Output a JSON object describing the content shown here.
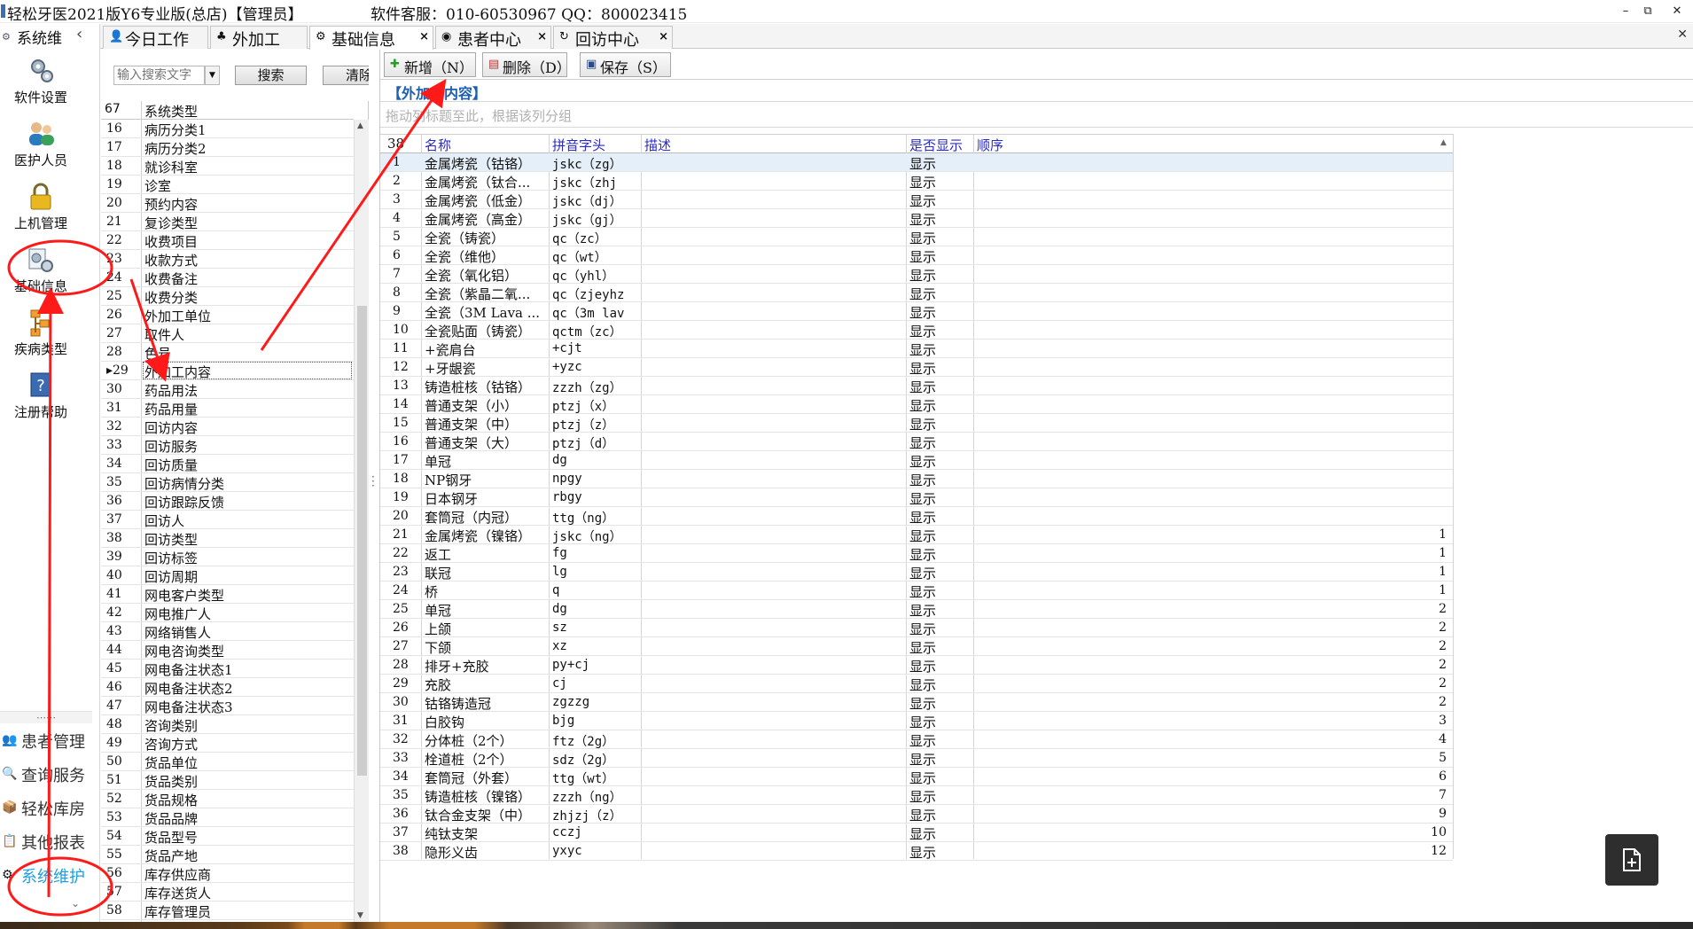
{
  "window": {
    "title": "轻松牙医2021版Y6专业版(总店)【管理员】",
    "service": "软件客服：010-60530967 QQ：800023415",
    "min_glyph": "–",
    "max_glyph": "⧉",
    "close_glyph": "✕"
  },
  "leftnav": {
    "header": "系统维",
    "collapse_glyph": "‹",
    "big_items": [
      {
        "label": "软件设置",
        "icon": "gears-icon"
      },
      {
        "label": "医护人员",
        "icon": "staff-icon"
      },
      {
        "label": "上机管理",
        "icon": "lock-icon"
      },
      {
        "label": "基础信息",
        "icon": "basic-info-icon"
      },
      {
        "label": "疾病类型",
        "icon": "disease-type-icon"
      },
      {
        "label": "注册帮助",
        "icon": "help-icon"
      }
    ],
    "separator": "⋯⋯",
    "small_items": [
      {
        "label": "患者管理",
        "icon": "patients-icon"
      },
      {
        "label": "查询服务",
        "icon": "query-icon"
      },
      {
        "label": "轻松库房",
        "icon": "warehouse-icon"
      },
      {
        "label": "其他报表",
        "icon": "report-icon"
      },
      {
        "label": "系统维护",
        "icon": "maintenance-icon"
      }
    ],
    "scroll_glyph": "⌄"
  },
  "tabs": [
    {
      "label": "今日工作",
      "icon": "work-icon",
      "closable": false
    },
    {
      "label": "外加工",
      "icon": "outsource-icon",
      "closable": false
    },
    {
      "label": "基础信息",
      "icon": "basic-info-icon",
      "closable": true
    },
    {
      "label": "患者中心",
      "icon": "patient-center-icon",
      "closable": true
    },
    {
      "label": "回访中心",
      "icon": "revisit-center-icon",
      "closable": true
    }
  ],
  "tab_close_glyph": "×",
  "search": {
    "placeholder": "输入搜索文字",
    "search_label": "搜索",
    "clear_label": "清除"
  },
  "categories": {
    "count": "67",
    "header": "系统类型",
    "rows": [
      {
        "num": "16",
        "name": "病历分类1"
      },
      {
        "num": "17",
        "name": "病历分类2"
      },
      {
        "num": "18",
        "name": "就诊科室"
      },
      {
        "num": "19",
        "name": "诊室"
      },
      {
        "num": "20",
        "name": "预约内容"
      },
      {
        "num": "21",
        "name": "复诊类型"
      },
      {
        "num": "22",
        "name": "收费项目"
      },
      {
        "num": "23",
        "name": "收款方式"
      },
      {
        "num": "24",
        "name": "收费备注"
      },
      {
        "num": "25",
        "name": "收费分类"
      },
      {
        "num": "26",
        "name": "外加工单位"
      },
      {
        "num": "27",
        "name": "取件人"
      },
      {
        "num": "28",
        "name": "色号"
      },
      {
        "num": "29",
        "name": "外加工内容",
        "selected": true
      },
      {
        "num": "30",
        "name": "药品用法"
      },
      {
        "num": "31",
        "name": "药品用量"
      },
      {
        "num": "32",
        "name": "回访内容"
      },
      {
        "num": "33",
        "name": "回访服务"
      },
      {
        "num": "34",
        "name": "回访质量"
      },
      {
        "num": "35",
        "name": "回访病情分类"
      },
      {
        "num": "36",
        "name": "回访跟踪反馈"
      },
      {
        "num": "37",
        "name": "回访人"
      },
      {
        "num": "38",
        "name": "回访类型"
      },
      {
        "num": "39",
        "name": "回访标签"
      },
      {
        "num": "40",
        "name": "回访周期"
      },
      {
        "num": "41",
        "name": "网电客户类型"
      },
      {
        "num": "42",
        "name": "网电推广人"
      },
      {
        "num": "43",
        "name": "网络销售人"
      },
      {
        "num": "44",
        "name": "网电咨询类型"
      },
      {
        "num": "45",
        "name": "网电备注状态1"
      },
      {
        "num": "46",
        "name": "网电备注状态2"
      },
      {
        "num": "47",
        "name": "网电备注状态3"
      },
      {
        "num": "48",
        "name": "咨询类别"
      },
      {
        "num": "49",
        "name": "咨询方式"
      },
      {
        "num": "50",
        "name": "货品单位"
      },
      {
        "num": "51",
        "name": "货品类别"
      },
      {
        "num": "52",
        "name": "货品规格"
      },
      {
        "num": "53",
        "name": "货品品牌"
      },
      {
        "num": "54",
        "name": "货品型号"
      },
      {
        "num": "55",
        "name": "货品产地"
      },
      {
        "num": "56",
        "name": "库存供应商"
      },
      {
        "num": "57",
        "name": "库存送货人"
      },
      {
        "num": "58",
        "name": "库存管理员"
      }
    ]
  },
  "toolbar": {
    "add_label": "新增（N）",
    "delete_label": "删除（D）",
    "save_label": "保存（S）"
  },
  "content": {
    "section_title": "【外加工内容】",
    "group_hint": "拖动列标题至此，根据该列分组"
  },
  "grid": {
    "count": "38",
    "columns": {
      "name": "名称",
      "pinyin": "拼音字头",
      "desc": "描述",
      "show": "是否显示",
      "order": "顺序"
    },
    "sort_glyph": "▲",
    "rows": [
      {
        "num": "1",
        "name": "金属烤瓷（钴铬）",
        "pinyin": "jskc（zg）",
        "desc": "",
        "show": "显示",
        "order": ""
      },
      {
        "num": "2",
        "name": "金属烤瓷（钛合...",
        "pinyin": "jskc（zhj",
        "desc": "",
        "show": "显示",
        "order": ""
      },
      {
        "num": "3",
        "name": "金属烤瓷（低金）",
        "pinyin": "jskc（dj）",
        "desc": "",
        "show": "显示",
        "order": ""
      },
      {
        "num": "4",
        "name": "金属烤瓷（高金）",
        "pinyin": "jskc（gj）",
        "desc": "",
        "show": "显示",
        "order": ""
      },
      {
        "num": "5",
        "name": "全瓷（铸瓷）",
        "pinyin": "qc（zc）",
        "desc": "",
        "show": "显示",
        "order": ""
      },
      {
        "num": "6",
        "name": "全瓷（维他）",
        "pinyin": "qc（wt）",
        "desc": "",
        "show": "显示",
        "order": ""
      },
      {
        "num": "7",
        "name": "全瓷（氧化铝）",
        "pinyin": "qc（yhl）",
        "desc": "",
        "show": "显示",
        "order": ""
      },
      {
        "num": "8",
        "name": "全瓷（紫晶二氧...",
        "pinyin": "qc（zjeyhz",
        "desc": "",
        "show": "显示",
        "order": ""
      },
      {
        "num": "9",
        "name": "全瓷（3M Lava ...",
        "pinyin": "qc（3m lav",
        "desc": "",
        "show": "显示",
        "order": ""
      },
      {
        "num": "10",
        "name": "全瓷贴面（铸瓷）",
        "pinyin": "qctm（zc）",
        "desc": "",
        "show": "显示",
        "order": ""
      },
      {
        "num": "11",
        "name": "+瓷肩台",
        "pinyin": "+cjt",
        "desc": "",
        "show": "显示",
        "order": ""
      },
      {
        "num": "12",
        "name": "+牙龈瓷",
        "pinyin": "+yzc",
        "desc": "",
        "show": "显示",
        "order": ""
      },
      {
        "num": "13",
        "name": "铸造桩核（钴铬）",
        "pinyin": "zzzh（zg）",
        "desc": "",
        "show": "显示",
        "order": ""
      },
      {
        "num": "14",
        "name": "普通支架（小）",
        "pinyin": "ptzj（x）",
        "desc": "",
        "show": "显示",
        "order": ""
      },
      {
        "num": "15",
        "name": "普通支架（中）",
        "pinyin": "ptzj（z）",
        "desc": "",
        "show": "显示",
        "order": ""
      },
      {
        "num": "16",
        "name": "普通支架（大）",
        "pinyin": "ptzj（d）",
        "desc": "",
        "show": "显示",
        "order": ""
      },
      {
        "num": "17",
        "name": "单冠",
        "pinyin": "dg",
        "desc": "",
        "show": "显示",
        "order": ""
      },
      {
        "num": "18",
        "name": "NP钢牙",
        "pinyin": "npgy",
        "desc": "",
        "show": "显示",
        "order": ""
      },
      {
        "num": "19",
        "name": "日本钢牙",
        "pinyin": "rbgy",
        "desc": "",
        "show": "显示",
        "order": ""
      },
      {
        "num": "20",
        "name": "套筒冠（内冠）",
        "pinyin": "ttg（ng）",
        "desc": "",
        "show": "显示",
        "order": ""
      },
      {
        "num": "21",
        "name": "金属烤瓷（镍铬）",
        "pinyin": "jskc（ng）",
        "desc": "",
        "show": "显示",
        "order": "1"
      },
      {
        "num": "22",
        "name": "返工",
        "pinyin": "fg",
        "desc": "",
        "show": "显示",
        "order": "1"
      },
      {
        "num": "23",
        "name": "联冠",
        "pinyin": "lg",
        "desc": "",
        "show": "显示",
        "order": "1"
      },
      {
        "num": "24",
        "name": "桥",
        "pinyin": "q",
        "desc": "",
        "show": "显示",
        "order": "1"
      },
      {
        "num": "25",
        "name": "单冠",
        "pinyin": "dg",
        "desc": "",
        "show": "显示",
        "order": "2"
      },
      {
        "num": "26",
        "name": "上颌",
        "pinyin": "sz",
        "desc": "",
        "show": "显示",
        "order": "2"
      },
      {
        "num": "27",
        "name": "下颌",
        "pinyin": "xz",
        "desc": "",
        "show": "显示",
        "order": "2"
      },
      {
        "num": "28",
        "name": "排牙+充胶",
        "pinyin": "py+cj",
        "desc": "",
        "show": "显示",
        "order": "2"
      },
      {
        "num": "29",
        "name": "充胶",
        "pinyin": "cj",
        "desc": "",
        "show": "显示",
        "order": "2"
      },
      {
        "num": "30",
        "name": "钴铬铸造冠",
        "pinyin": "zgzzg",
        "desc": "",
        "show": "显示",
        "order": "2"
      },
      {
        "num": "31",
        "name": " 白胶钩",
        "pinyin": " bjg",
        "desc": "",
        "show": "显示",
        "order": "3"
      },
      {
        "num": "32",
        "name": "分体桩（2个）",
        "pinyin": "ftz（2g）",
        "desc": "",
        "show": "显示",
        "order": "4"
      },
      {
        "num": "33",
        "name": "栓道桩（2个）",
        "pinyin": "sdz（2g）",
        "desc": "",
        "show": "显示",
        "order": "5"
      },
      {
        "num": "34",
        "name": "套筒冠（外套）",
        "pinyin": "ttg（wt）",
        "desc": "",
        "show": "显示",
        "order": "6"
      },
      {
        "num": "35",
        "name": "铸造桩核（镍铬）",
        "pinyin": "zzzh（ng）",
        "desc": "",
        "show": "显示",
        "order": "7"
      },
      {
        "num": "36",
        "name": "钛合金支架（中）",
        "pinyin": "zhjzj（z）",
        "desc": "",
        "show": "显示",
        "order": "9"
      },
      {
        "num": "37",
        "name": "纯钛支架",
        "pinyin": "cczj",
        "desc": "",
        "show": "显示",
        "order": "10"
      },
      {
        "num": "38",
        "name": "隐形义齿",
        "pinyin": "yxyc",
        "desc": "",
        "show": "显示",
        "order": "12"
      }
    ]
  },
  "colors": {
    "accent_blue": "#1b5fb0",
    "header_blue": "#2a2acf",
    "annotation_red": "#ff1a1a",
    "active_nav": "#1aa0e6"
  }
}
